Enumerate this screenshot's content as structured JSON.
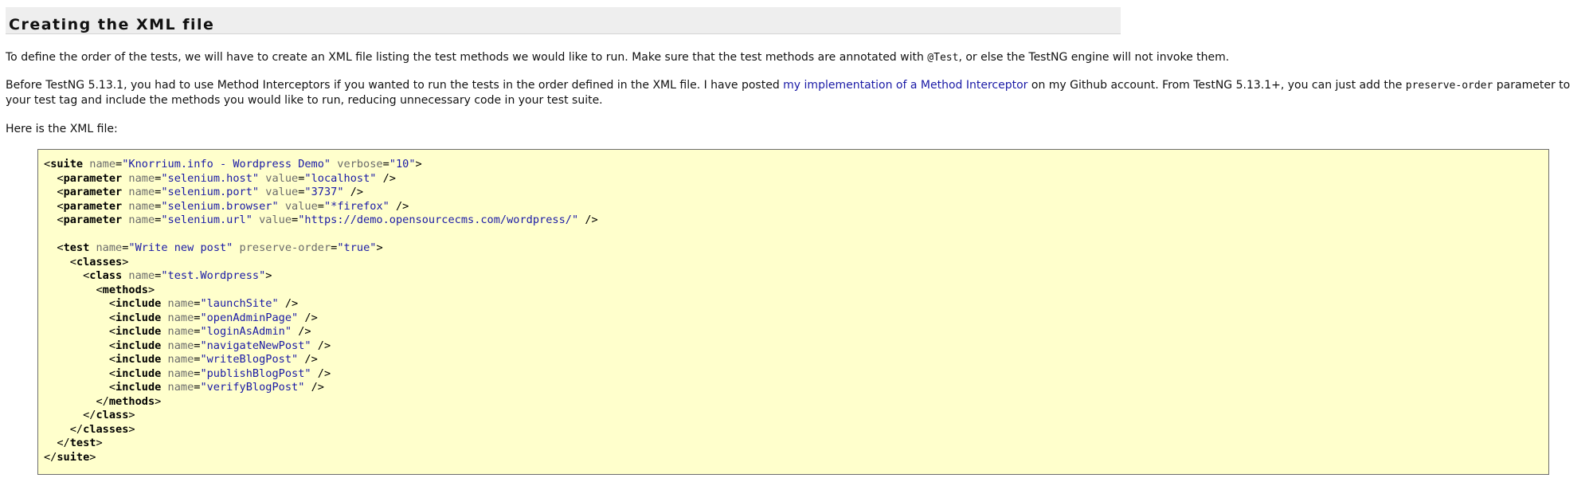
{
  "heading": "Creating the XML file",
  "paragraphs": {
    "p1_before": "To define the order of the tests, we will have to create an XML file listing the test methods we would like to run. Make sure that the test methods are annotated with ",
    "p1_code": "@Test",
    "p1_after": ", or else the TestNG engine will not invoke them.",
    "p2_before": "Before TestNG 5.13.1, you had to use Method Interceptors if you wanted to run the tests in the order defined in the XML file. I have posted ",
    "p2_link": "my implementation of a Method Interceptor",
    "p2_middle": " on my Github account. From TestNG 5.13.1+, you can just add the ",
    "p2_code": "preserve-order",
    "p2_after": " parameter to",
    "p2_line2": "your test tag and include the methods you would like to run, reducing unnecessary code in your test suite.",
    "p3": "Here is the XML file:"
  },
  "code": {
    "suite": {
      "tag": "suite",
      "name": "Knorrium.info - Wordpress Demo",
      "verbose": "10"
    },
    "parameters": [
      {
        "name": "selenium.host",
        "value": "localhost"
      },
      {
        "name": "selenium.port",
        "value": "3737"
      },
      {
        "name": "selenium.browser",
        "value": "*firefox"
      },
      {
        "name": "selenium.url",
        "value": "https://demo.opensourcecms.com/wordpress/"
      }
    ],
    "test": {
      "name": "Write new post",
      "preserve_order": "true"
    },
    "class_name": "test.Wordpress",
    "includes": [
      "launchSite",
      "openAdminPage",
      "loginAsAdmin",
      "navigateNewPost",
      "writeBlogPost",
      "publishBlogPost",
      "verifyBlogPost"
    ]
  }
}
